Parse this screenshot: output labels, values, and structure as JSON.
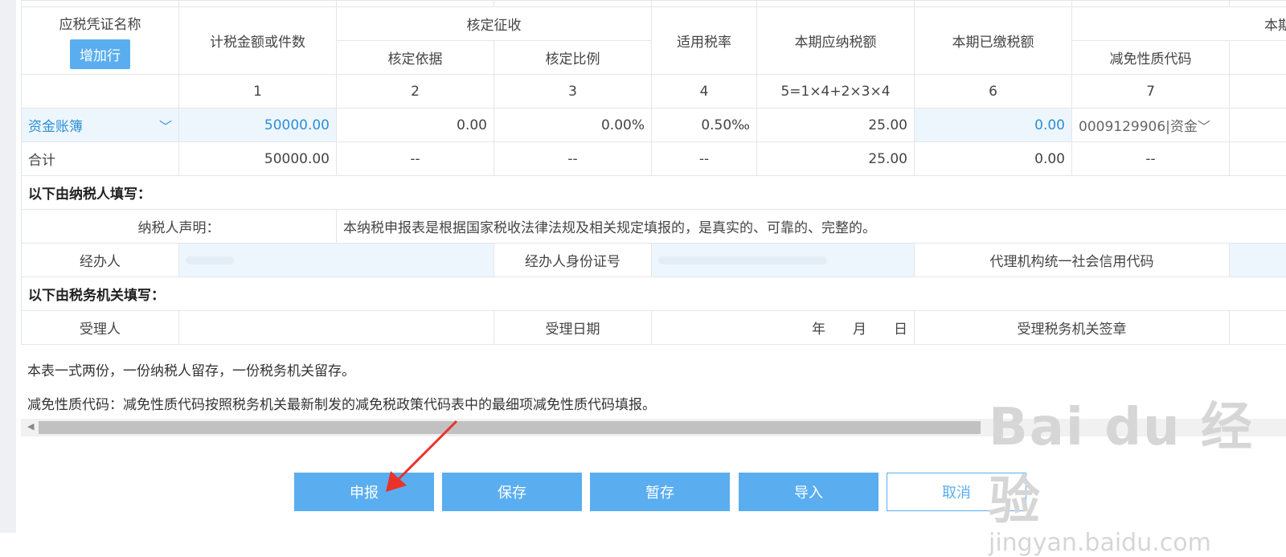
{
  "table": {
    "header": {
      "col_name": "应税凭证名称",
      "add_row": "增加行",
      "col_amount": "计税金额或件数",
      "group_assess": "核定征收",
      "col_basis": "核定依据",
      "col_ratio": "核定比例",
      "col_rate": "适用税率",
      "col_payable": "本期应纳税额",
      "col_paid": "本期已缴税额",
      "group_relief": "本期减免税",
      "col_relief_code": "减免性质代码"
    },
    "index_row": [
      "1",
      "2",
      "3",
      "4",
      "5=1×4+2×3×4",
      "6",
      "7"
    ],
    "data_row": {
      "name": "资金账簿",
      "amount": "50000.00",
      "basis": "0.00",
      "ratio": "0.00%",
      "rate": "0.50‰",
      "payable": "25.00",
      "paid": "0.00",
      "relief_code": "0009129906|资金"
    },
    "total_row": {
      "label": "合计",
      "amount": "50000.00",
      "basis": "--",
      "ratio": "--",
      "rate": "--",
      "payable": "25.00",
      "paid": "0.00",
      "relief_code": "--"
    },
    "taxpayer_section": "以下由纳税人填写：",
    "declaration_label": "纳税人声明：",
    "declaration_text": "本纳税申报表是根据国家税收法律法规及相关规定填报的，是真实的、可靠的、完整的。",
    "handler_label": "经办人",
    "handler_id_label": "经办人身份证号",
    "agency_code_label": "代理机构统一社会信用代码",
    "authority_section": "以下由税务机关填写：",
    "receiver_label": "受理人",
    "receive_date_label": "受理日期",
    "date_text": "年　　月　　日",
    "seal_label": "受理税务机关签章"
  },
  "notes": {
    "copies": "本表一式两份，一份纳税人留存，一份税务机关留存。",
    "relief_note": "减免性质代码：减免性质代码按照税务机关最新制发的减免税政策代码表中的最细项减免性质代码填报。"
  },
  "buttons": {
    "submit": "申报",
    "save": "保存",
    "temp_save": "暂存",
    "import": "导入",
    "cancel": "取消"
  },
  "watermark": {
    "logo": "Bai du 经验",
    "url": "jingyan.baidu.com"
  },
  "colors": {
    "accent": "#5aaef0",
    "link": "#2b8fd6",
    "arrow": "#e8322b"
  }
}
